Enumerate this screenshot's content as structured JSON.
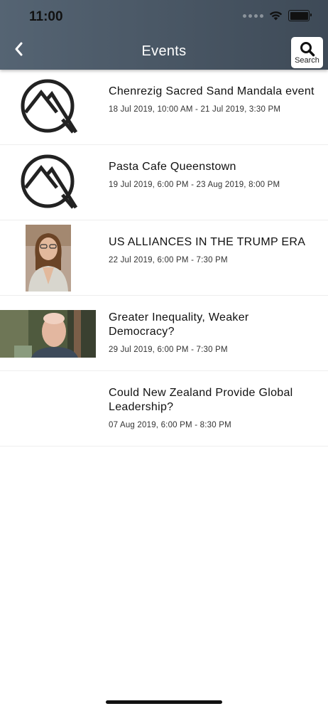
{
  "status_bar": {
    "time": "11:00"
  },
  "header": {
    "title": "Events",
    "search_label": "Search"
  },
  "events": [
    {
      "title": "Chenrezig Sacred Sand Mandala event",
      "date": "18 Jul 2019, 10:00 AM - 21 Jul 2019, 3:30 PM",
      "image": "mountain-logo"
    },
    {
      "title": "Pasta Cafe Queenstown",
      "date": "19 Jul 2019, 6:00 PM - 23 Aug 2019, 8:00 PM",
      "image": "mountain-logo"
    },
    {
      "title": "US ALLIANCES IN THE TRUMP ERA",
      "date": "22 Jul 2019, 6:00 PM - 7:30 PM",
      "image": "woman-portrait"
    },
    {
      "title": "Greater Inequality, Weaker Democracy?",
      "date": "29 Jul 2019, 6:00 PM - 7:30 PM",
      "image": "man-portrait"
    },
    {
      "title": "Could New Zealand Provide Global Leadership?",
      "date": "07 Aug 2019, 6:00 PM - 8:30 PM",
      "image": ""
    }
  ]
}
